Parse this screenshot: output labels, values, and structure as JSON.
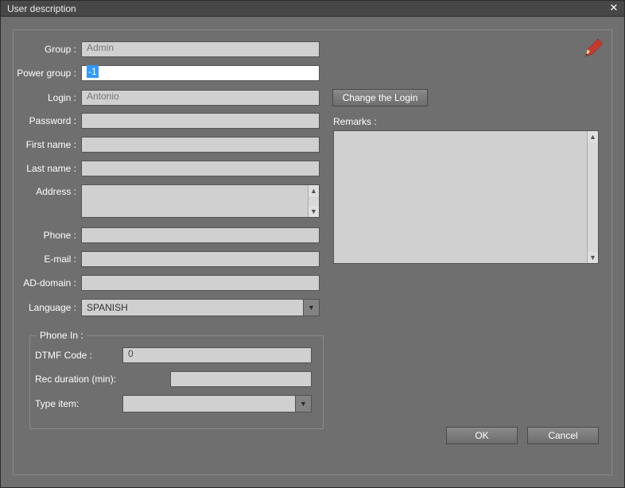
{
  "window": {
    "title": "User description"
  },
  "form": {
    "group_label": "Group :",
    "group_value": "Admin",
    "powergroup_label": "Power group :",
    "powergroup_value": "-1",
    "login_label": "Login :",
    "login_value": "Antonio",
    "change_login_btn": "Change the Login",
    "password_label": "Password :",
    "password_value": "",
    "firstname_label": "First name :",
    "firstname_value": "",
    "lastname_label": "Last name :",
    "lastname_value": "",
    "address_label": "Address :",
    "address_value": "",
    "phone_label": "Phone :",
    "phone_value": "",
    "email_label": "E-mail :",
    "email_value": "",
    "addomain_label": "AD-domain :",
    "addomain_value": "",
    "language_label": "Language :",
    "language_value": "SPANISH"
  },
  "remarks": {
    "label": "Remarks :",
    "value": ""
  },
  "phonein": {
    "legend": "Phone In :",
    "dtmf_label": "DTMF Code :",
    "dtmf_value": "0",
    "recdur_label": "Rec duration (min):",
    "recdur_value": "",
    "typeitem_label": "Type item:",
    "typeitem_value": ""
  },
  "buttons": {
    "ok": "OK",
    "cancel": "Cancel"
  }
}
